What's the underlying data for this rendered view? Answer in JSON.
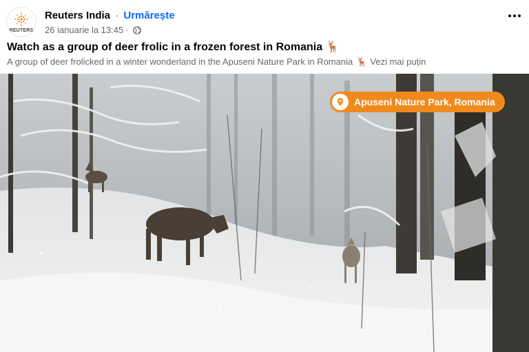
{
  "post": {
    "page_name": "Reuters India",
    "separator": "·",
    "follow_label": "Urmărește",
    "timestamp": "26 ianuarie la 13:45",
    "meta_separator": "·",
    "privacy_icon": "globe-icon",
    "more_icon": "more-options-icon",
    "avatar_text": "REUTERS",
    "title": "Watch as a group of deer frolic in a frozen forest in Romania",
    "title_emoji": "🦌",
    "text": "A group of deer frolicked in a winter wonderland in the Apuseni Nature Park in Romania",
    "text_emoji": "🦌",
    "see_more": "Vezi mai puțin"
  },
  "video": {
    "location_label": "Apuseni Nature Park, Romania",
    "location_icon": "map-pin-icon",
    "badge_color": "#f08a1c"
  },
  "colors": {
    "brand_blue": "#0866ff",
    "secondary_text": "#65676b",
    "reuters_orange": "#f08a1c"
  }
}
